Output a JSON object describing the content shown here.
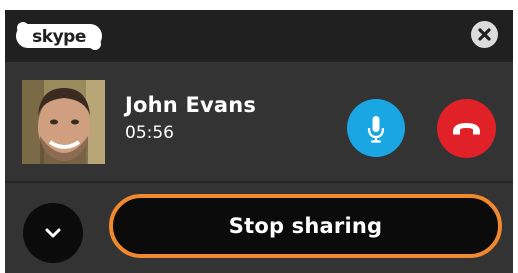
{
  "app": {
    "logo_text": "skype"
  },
  "call": {
    "contact_name": "John Evans",
    "duration": "05:56"
  },
  "actions": {
    "stop_sharing_label": "Stop sharing"
  },
  "icons": {
    "close": "close-icon",
    "mute": "microphone-icon",
    "end_call": "hang-up-icon",
    "expand": "chevron-down-icon"
  },
  "colors": {
    "panel_background": "#333333",
    "titlebar_background": "#202020",
    "mic_button": "#1aa6e3",
    "end_call_button": "#e02127",
    "stop_sharing_border": "#f0892e",
    "dark_button": "#0b0b0b"
  }
}
